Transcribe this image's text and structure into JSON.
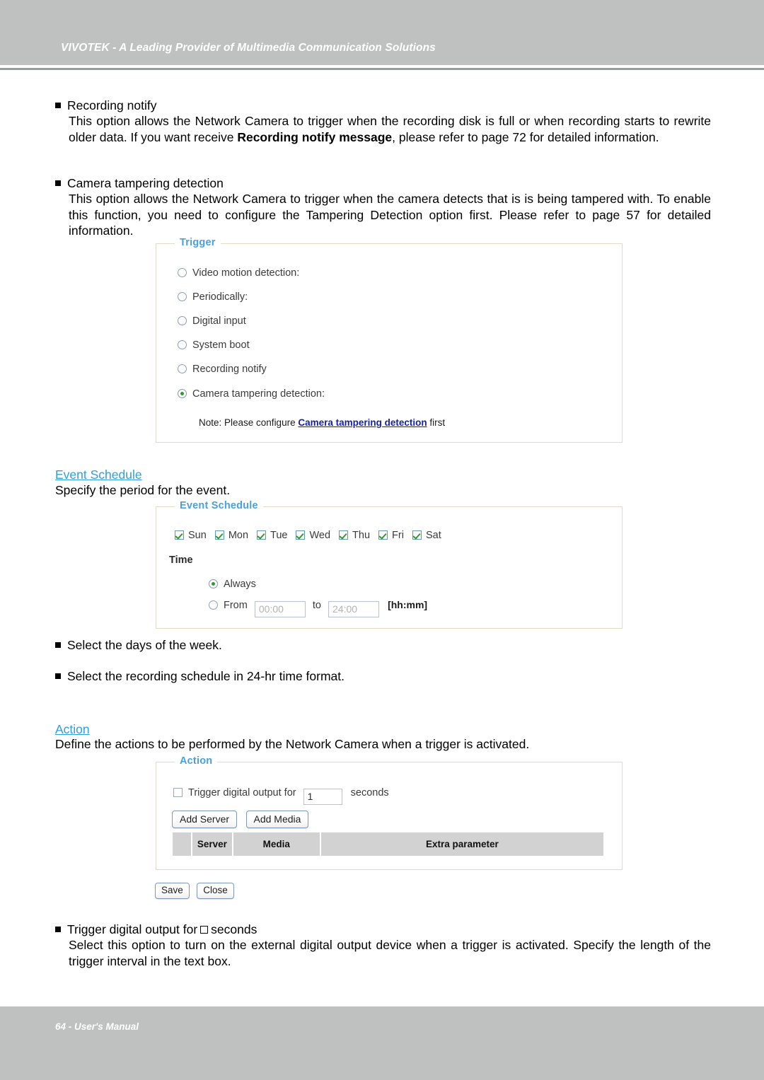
{
  "header": {
    "title": "VIVOTEK - A Leading Provider of Multimedia Communication Solutions"
  },
  "footer": {
    "text": "64 - User's Manual"
  },
  "body": {
    "bullets": [
      {
        "title": "Recording notify",
        "text_1": "This option allows the Network Camera to trigger when the recording disk is full or when recording starts to rewrite older data. If you want receive ",
        "emphasis": "Recording notify message",
        "text_2": ", please refer to page 72 for detailed information."
      },
      {
        "title": "Camera tampering detection",
        "text_1": "This option allows the Network Camera to trigger when the camera detects that is is being tampered with. To enable this function, you need to configure the Tampering Detection option first. Please refer to page 57 for detailed information."
      }
    ],
    "select_days_bullet": "Select the days of the week.",
    "select_schedule_bullet": "Select the recording schedule in 24-hr time format.",
    "trigger_output_bullet_pre": "Trigger digital output for",
    "trigger_output_bullet_post": "seconds",
    "trigger_output_body": "Select this option to turn on the external digital output device when a trigger is activated. Specify the length of the trigger interval in the text box."
  },
  "sections": {
    "event_schedule": {
      "heading": "Event Schedule",
      "subtitle": "Specify the period for the event."
    },
    "action": {
      "heading": "Action",
      "subtitle": "Define the actions to be performed by the Network Camera when a trigger is activated."
    }
  },
  "trigger_panel": {
    "legend": "Trigger",
    "options": [
      {
        "label": "Video motion detection:",
        "selected": false
      },
      {
        "label": "Periodically:",
        "selected": false
      },
      {
        "label": "Digital input",
        "selected": false
      },
      {
        "label": "System boot",
        "selected": false
      },
      {
        "label": "Recording notify",
        "selected": false
      },
      {
        "label": "Camera tampering detection:",
        "selected": true
      }
    ],
    "note_prefix": "Note: Please configure",
    "note_link": "Camera tampering detection",
    "note_suffix": "first"
  },
  "event_schedule_panel": {
    "legend": "Event Schedule",
    "days": [
      {
        "label": "Sun",
        "checked": true
      },
      {
        "label": "Mon",
        "checked": true
      },
      {
        "label": "Tue",
        "checked": true
      },
      {
        "label": "Wed",
        "checked": true
      },
      {
        "label": "Thu",
        "checked": true
      },
      {
        "label": "Fri",
        "checked": true
      },
      {
        "label": "Sat",
        "checked": true
      }
    ],
    "time_label": "Time",
    "always_label": "Always",
    "always_selected": true,
    "from_label": "From",
    "from_value": "00:00",
    "to_label": "to",
    "to_value": "24:00",
    "format_hint": "[hh:mm]"
  },
  "action_panel": {
    "legend": "Action",
    "trigger_output_label": "Trigger digital output for",
    "trigger_output_checked": false,
    "seconds_value": "1",
    "seconds_label": "seconds",
    "add_server_label": "Add Server",
    "add_media_label": "Add Media",
    "table_headers": [
      "",
      "Server",
      "Media",
      "Extra parameter"
    ],
    "save_label": "Save",
    "close_label": "Close"
  },
  "colors": {
    "header_bar": "#bfc0c0",
    "legend_blue": "#4a9fe0",
    "section_blue": "#2f9fd8",
    "link_blue": "#141ea8",
    "check_green": "#2e9b32",
    "table_header_gray": "#d2d2d2"
  }
}
